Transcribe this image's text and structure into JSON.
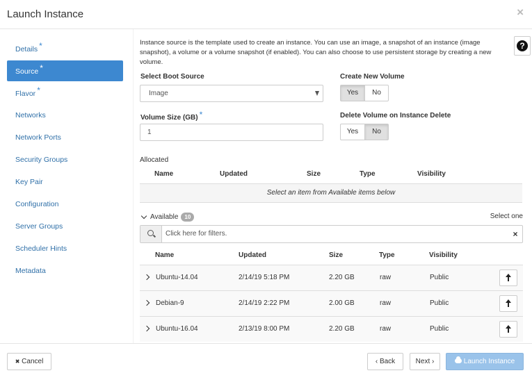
{
  "modal": {
    "title": "Launch Instance",
    "close": "×"
  },
  "sidebar": {
    "items": [
      {
        "label": "Details",
        "required": "*"
      },
      {
        "label": "Source",
        "required": "*"
      },
      {
        "label": "Flavor",
        "required": "*"
      },
      {
        "label": "Networks",
        "required": ""
      },
      {
        "label": "Network Ports",
        "required": ""
      },
      {
        "label": "Security Groups",
        "required": ""
      },
      {
        "label": "Key Pair",
        "required": ""
      },
      {
        "label": "Configuration",
        "required": ""
      },
      {
        "label": "Server Groups",
        "required": ""
      },
      {
        "label": "Scheduler Hints",
        "required": ""
      },
      {
        "label": "Metadata",
        "required": ""
      }
    ],
    "active": "Source"
  },
  "help": {
    "glyph": "?"
  },
  "source": {
    "intro": "Instance source is the template used to create an instance. You can use an image, a snapshot of an instance (image snapshot), a volume or a volume snapshot (if enabled). You can also choose to use persistent storage by creating a new volume.",
    "boot_source_label": "Select Boot Source",
    "boot_source_value": "Image",
    "volume_size_label": "Volume Size (GB)",
    "volume_size_required": "*",
    "volume_size_value": "1",
    "create_volume_label": "Create New Volume",
    "create_volume_yes": "Yes",
    "create_volume_no": "No",
    "create_volume_selected": "Yes",
    "delete_volume_label": "Delete Volume on Instance Delete",
    "delete_volume_yes": "Yes",
    "delete_volume_no": "No",
    "delete_volume_selected": "No"
  },
  "allocated": {
    "label": "Allocated",
    "columns": [
      "Name",
      "Updated",
      "Size",
      "Type",
      "Visibility"
    ],
    "empty_text": "Select an item from Available items below"
  },
  "available": {
    "label": "Available",
    "count": "10",
    "select_hint": "Select one",
    "filter_placeholder": "Click here for filters.",
    "clear": "×",
    "columns": [
      "Name",
      "Updated",
      "Size",
      "Type",
      "Visibility"
    ],
    "rows": [
      {
        "name": "Ubuntu-14.04",
        "updated": "2/14/19 5:18 PM",
        "size": "2.20 GB",
        "type": "raw",
        "visibility": "Public"
      },
      {
        "name": "Debian-9",
        "updated": "2/14/19 2:22 PM",
        "size": "2.00 GB",
        "type": "raw",
        "visibility": "Public"
      },
      {
        "name": "Ubuntu-16.04",
        "updated": "2/13/19 8:00 PM",
        "size": "2.20 GB",
        "type": "raw",
        "visibility": "Public"
      }
    ]
  },
  "footer": {
    "cancel": "Cancel",
    "back": "Back",
    "next": "Next",
    "launch": "Launch Instance",
    "cancel_glyph": "✖",
    "back_glyph": "‹",
    "next_glyph": "›"
  }
}
